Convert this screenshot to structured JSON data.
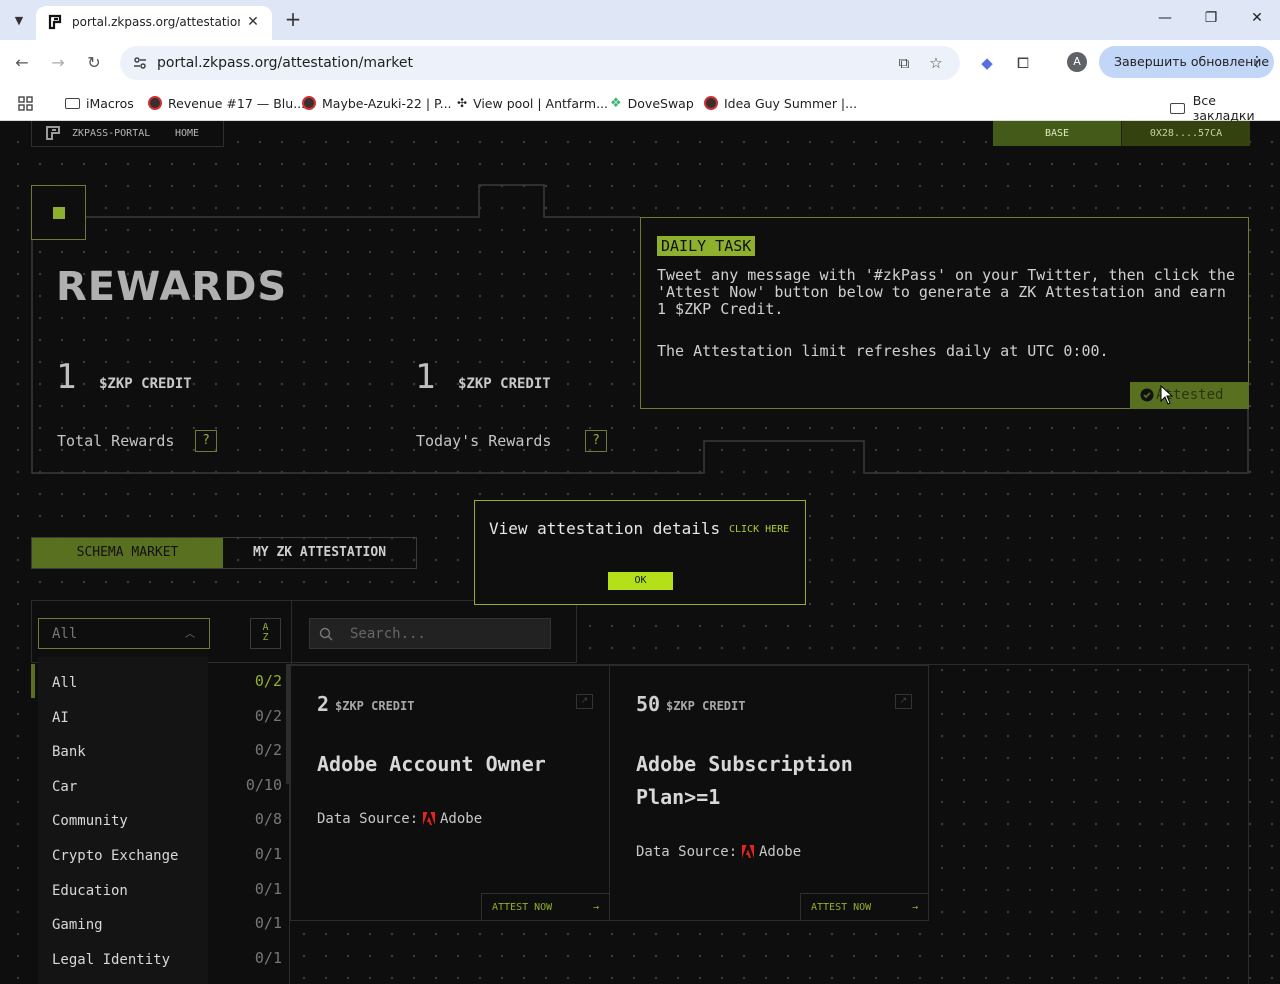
{
  "browser": {
    "tab_title": "portal.zkpass.org/attestation/m",
    "url": "portal.zkpass.org/attestation/market",
    "update_button": "Завершить обновление",
    "avatar_letter": "A",
    "bookmarks": [
      "iMacros",
      "Revenue #17 — Blu...",
      "Maybe-Azuki-22 | P...",
      "View pool | Antfarm...",
      "DoveSwap",
      "Idea Guy Summer |..."
    ],
    "all_bookmarks": "Все закладки"
  },
  "header": {
    "brand": "ZKPASS-PORTAL",
    "home": "HOME",
    "network": "BASE",
    "address": "0X28....57CA"
  },
  "rewards": {
    "title": "REWARDS",
    "total_value": "1",
    "total_unit": "$ZKP CREDIT",
    "total_label": "Total Rewards",
    "today_value": "1",
    "today_unit": "$ZKP CREDIT",
    "today_label": "Today's Rewards",
    "help": "?"
  },
  "daily_task": {
    "title": "DAILY TASK",
    "text": "Tweet any message with '#zkPass' on your Twitter, then click the 'Attest Now' button below to generate a ZK Attestation and earn 1 $ZKP Credit.",
    "note": "The Attestation limit refreshes daily at UTC 0:00.",
    "status": "Attested"
  },
  "tabs": {
    "schema_market": "SCHEMA MARKET",
    "my_attestation": "MY ZK ATTESTATION"
  },
  "modal": {
    "text": "View attestation details",
    "link": "CLICK HERE",
    "ok": "OK"
  },
  "filters": {
    "category_selected": "All",
    "sort_label": "AZ",
    "search_placeholder": "Search..."
  },
  "categories": [
    {
      "name": "All",
      "count": "0/2"
    },
    {
      "name": "AI",
      "count": "0/2"
    },
    {
      "name": "Bank",
      "count": "0/2"
    },
    {
      "name": "Car",
      "count": "0/10"
    },
    {
      "name": "Community",
      "count": "0/8"
    },
    {
      "name": "Crypto Exchange",
      "count": "0/1"
    },
    {
      "name": "Education",
      "count": "0/1"
    },
    {
      "name": "Gaming",
      "count": "0/1"
    },
    {
      "name": "Legal Identity",
      "count": "0/1"
    }
  ],
  "cards": [
    {
      "credit": "2",
      "unit": "$ZKP CREDIT",
      "title": "Adobe Account Owner",
      "source_label": "Data Source:",
      "source": "Adobe",
      "action": "ATTEST NOW"
    },
    {
      "credit": "50",
      "unit": "$ZKP CREDIT",
      "title": "Adobe Subscription Plan>=1",
      "source_label": "Data Source:",
      "source": "Adobe",
      "action": "ATTEST NOW"
    }
  ],
  "colors": {
    "accent": "#8fb02e",
    "accent_dark": "#5a7021",
    "background": "#0e0e0e",
    "modal_button": "#b4e01a"
  }
}
